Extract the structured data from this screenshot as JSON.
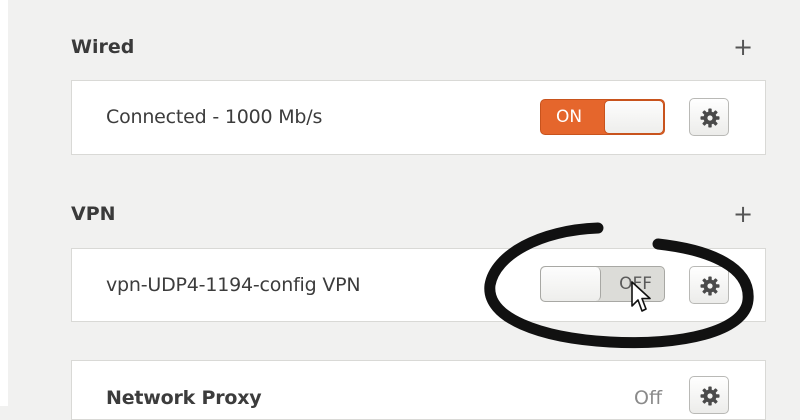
{
  "wired": {
    "title": "Wired",
    "add_icon": "+",
    "connection_label": "Connected - 1000 Mb/s",
    "switch_state": "ON"
  },
  "vpn": {
    "title": "VPN",
    "add_icon": "+",
    "connection_label": "vpn-UDP4-1194-config VPN",
    "switch_state": "OFF"
  },
  "proxy": {
    "title": "Network Proxy",
    "state": "Off"
  },
  "colors": {
    "accent_on": "#e5662c",
    "background": "#f1f1f0",
    "annotation_ink": "#111111"
  },
  "icons": {
    "add": "plus-icon",
    "settings": "gear-icon",
    "pointer": "mouse-cursor-icon",
    "annotation": "hand-drawn-circle"
  }
}
